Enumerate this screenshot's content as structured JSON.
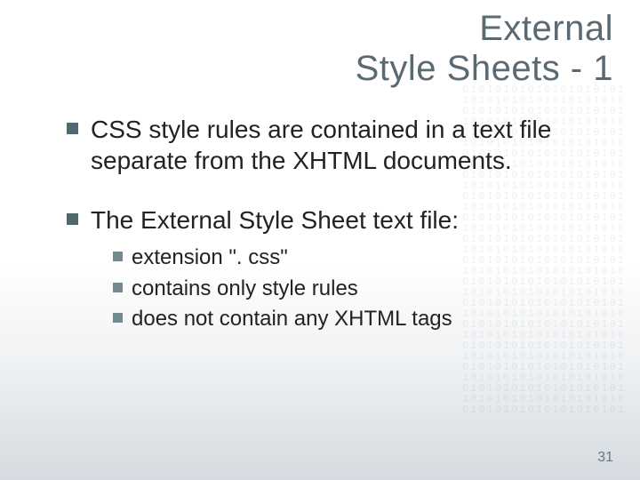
{
  "title": {
    "line1": "External",
    "line2": "Style Sheets - 1"
  },
  "bullets": [
    {
      "text": "CSS style rules are contained in a text file separate from the XHTML documents."
    },
    {
      "text": "The External Style Sheet text file:",
      "sub": [
        "extension \". css\"",
        "contains only style rules",
        "does not contain any XHTML tags"
      ]
    }
  ],
  "page_number": "31",
  "codepattern": "01010101010101010101\n10101010101010101010\n01010101010101010101\n10101010101010101010\n01010101010101010101\n10101010101010101010\n01010101010101010101\n10101010101010101010\n01010101010101010101\n10101010101010101010\n01010101010101010101\n10101010101010101010\n01010101010101010101\n10101010101010101010\n01010101010101010101\n10101010101010101010\n01010101010101010101\n10101010101010101010\n01010101010101010101\n10101010101010101010\n01010101010101010101\n10101010101010101010\n01010101010101010101\n10101010101010101010\n01010101010101010101\n10101010101010101010\n01010101010101010101\n10101010101010101010\n01010101010101010101\n10101010101010101010\n01010101010101010101"
}
